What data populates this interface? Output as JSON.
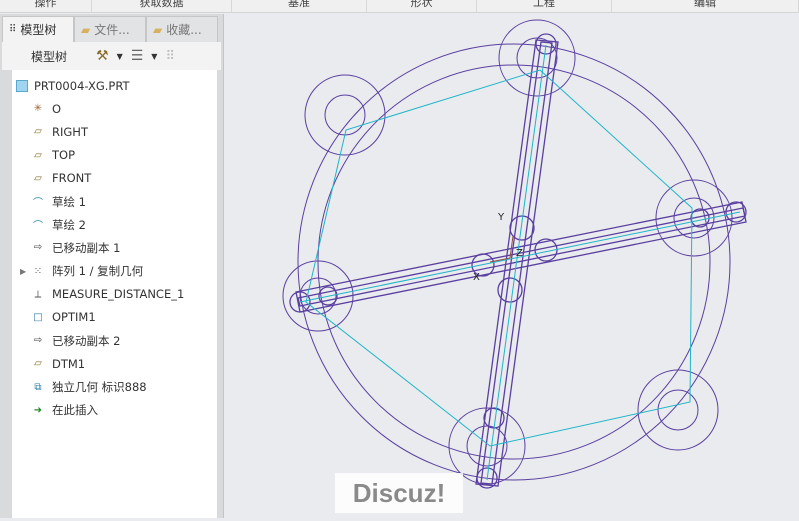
{
  "ribbon": [
    "操作",
    "获取数据",
    "基准",
    "形状",
    "工程",
    "编辑"
  ],
  "tabs": {
    "model_tree": "模型树",
    "files": "文件...",
    "favorites": "收藏..."
  },
  "toolbar": {
    "label": "模型树"
  },
  "tree": {
    "root": "PRT0004-XG.PRT",
    "items": [
      {
        "label": "O",
        "icon": "csys-icon"
      },
      {
        "label": "RIGHT",
        "icon": "datum-plane-icon"
      },
      {
        "label": "TOP",
        "icon": "datum-plane-icon"
      },
      {
        "label": "FRONT",
        "icon": "datum-plane-icon"
      },
      {
        "label": "草绘 1",
        "icon": "sketch-icon"
      },
      {
        "label": "草绘 2",
        "icon": "sketch-icon"
      },
      {
        "label": "已移动副本 1",
        "icon": "moved-copy-icon"
      },
      {
        "label": "阵列 1 / 复制几何",
        "icon": "pattern-icon"
      },
      {
        "label": "MEASURE_DISTANCE_1",
        "icon": "measure-icon"
      },
      {
        "label": "OPTIM1",
        "icon": "optim-icon"
      },
      {
        "label": "已移动副本 2",
        "icon": "moved-copy-icon"
      },
      {
        "label": "DTM1",
        "icon": "datum-plane-icon"
      },
      {
        "label": "独立几何 标识888",
        "icon": "independent-geometry-icon"
      },
      {
        "label": "在此插入",
        "icon": "insert-here-icon"
      }
    ]
  },
  "viewport": {
    "axis_x": "X",
    "axis_y": "Y",
    "axis_z": "Z"
  },
  "watermark": "Discuz!",
  "colors": {
    "geometry": "#5a3fa0",
    "sketch": "#1fb5c9"
  }
}
